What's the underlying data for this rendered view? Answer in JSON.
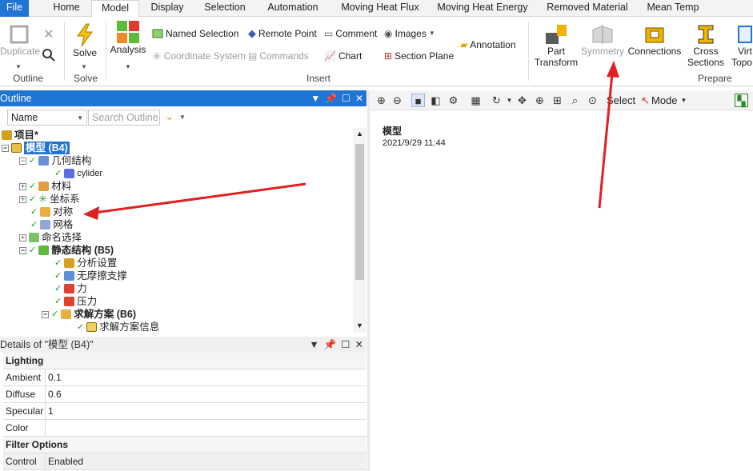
{
  "tabs": [
    "File",
    "Home",
    "Model",
    "Display",
    "Selection",
    "Automation",
    "Moving Heat Flux",
    "Moving Heat Energy",
    "Removed Material",
    "Mean Temp"
  ],
  "ribbon": {
    "outline_group": {
      "duplicate": "Duplicate",
      "label": "Outline"
    },
    "solve_group": {
      "solve": "Solve",
      "label": "Solve"
    },
    "insert_group": {
      "analysis": "Analysis",
      "named_selection": "Named Selection",
      "coordinate_system": "Coordinate System",
      "remote_point": "Remote Point",
      "commands": "Commands",
      "comment": "Comment",
      "chart": "Chart",
      "images": "Images",
      "section_plane": "Section Plane",
      "annotation": "Annotation",
      "label": "Insert"
    },
    "prepare_group": {
      "part_transform_line1": "Part",
      "part_transform_line2": "Transform",
      "symmetry": "Symmetry",
      "connections": "Connections",
      "cross_sections_line1": "Cross",
      "cross_sections_line2": "Sections",
      "virtual_topology_line1": "Virt",
      "virtual_topology_line2": "Topo",
      "label": "Prepare"
    }
  },
  "outline": {
    "title": "Outline",
    "name_select": "Name",
    "search_placeholder": "Search Outline",
    "tree": [
      {
        "label": "项目*",
        "bold": true
      },
      {
        "label": "模型 (B4)",
        "bold": true,
        "selected": true
      },
      {
        "label": "几何结构"
      },
      {
        "label": "cylider"
      },
      {
        "label": "材料"
      },
      {
        "label": "坐标系"
      },
      {
        "label": "对称"
      },
      {
        "label": "网格"
      },
      {
        "label": "命名选择"
      },
      {
        "label": "静态结构 (B5)",
        "bold": true
      },
      {
        "label": "分析设置"
      },
      {
        "label": "无摩擦支撑"
      },
      {
        "label": "力"
      },
      {
        "label": "压力"
      },
      {
        "label": "求解方案 (B6)",
        "bold": true
      },
      {
        "label": "求解方案信息"
      }
    ]
  },
  "details": {
    "title": "Details of \"模型 (B4)\"",
    "rows": [
      {
        "key": "Lighting",
        "value": "",
        "section": true
      },
      {
        "key": "Ambient",
        "value": "0.1"
      },
      {
        "key": "Diffuse",
        "value": "0.6"
      },
      {
        "key": "Specular",
        "value": "1"
      },
      {
        "key": "Color",
        "value": ""
      },
      {
        "key": "Filter Options",
        "value": "",
        "section": true
      },
      {
        "key": "Control",
        "value": "Enabled"
      }
    ]
  },
  "graphics": {
    "select_label": "Select",
    "mode_label": "Mode",
    "title": "模型",
    "timestamp": "2021/9/29 11:44"
  },
  "colors": {
    "accent": "#1f74d4",
    "annotation_arrow": "#e02020"
  }
}
